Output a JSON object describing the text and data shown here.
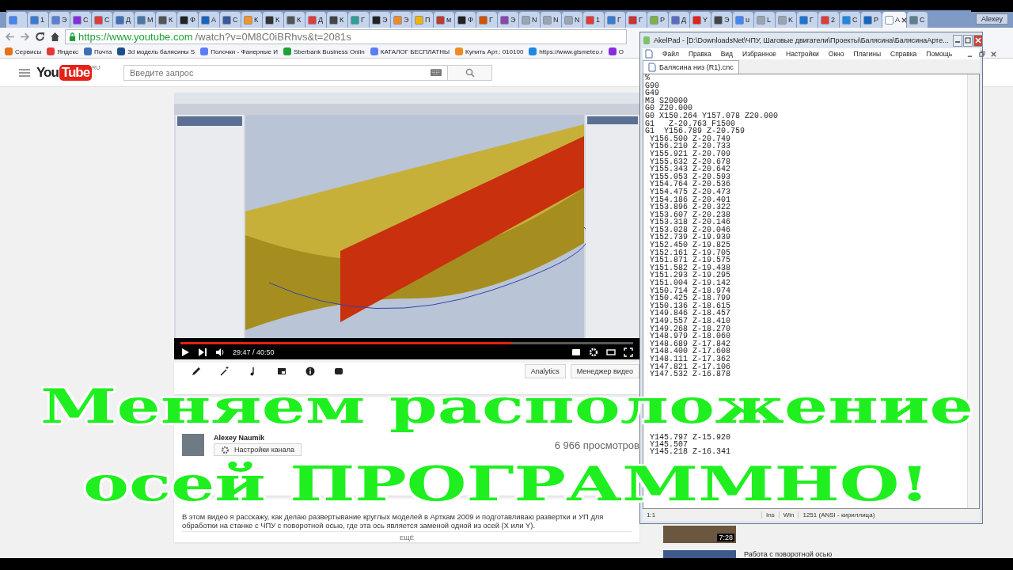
{
  "browser": {
    "tabs": [
      {
        "color": "#4285f4",
        "selected": false
      },
      {
        "label": "1",
        "color": "#3a7bd5",
        "selected": false
      },
      {
        "label": "Э",
        "color": "#5b7fd6",
        "selected": false
      },
      {
        "label": "С",
        "color": "#8a2be2",
        "selected": false
      },
      {
        "label": "С",
        "color": "#e53935",
        "selected": false
      },
      {
        "label": "Д",
        "color": "#3f6fb5",
        "selected": false
      },
      {
        "label": "М",
        "color": "#4a76a8",
        "selected": false
      },
      {
        "label": "К",
        "color": "#555555",
        "selected": false
      },
      {
        "label": "Ф",
        "color": "#222222",
        "selected": false
      },
      {
        "label": "А",
        "color": "#1565c0",
        "selected": false
      },
      {
        "label": "С",
        "color": "#3b5998",
        "selected": false
      },
      {
        "label": "К",
        "color": "#f7931e",
        "selected": false
      },
      {
        "label": "К",
        "color": "#333333",
        "selected": false
      },
      {
        "label": "К",
        "color": "#555555",
        "selected": false
      },
      {
        "label": "Д",
        "color": "#e53935",
        "selected": false
      },
      {
        "label": "К",
        "color": "#444444",
        "selected": false
      },
      {
        "label": "Г",
        "color": "#2aa198",
        "selected": false
      },
      {
        "label": "Э",
        "color": "#222222",
        "selected": false
      },
      {
        "label": "Э",
        "color": "#f08a24",
        "selected": false
      },
      {
        "label": "П",
        "color": "#f0b400",
        "selected": false
      },
      {
        "label": "м",
        "color": "#c0392b",
        "selected": false
      },
      {
        "label": "Ф",
        "color": "#222222",
        "selected": false
      },
      {
        "label": "Г",
        "color": "#d35400",
        "selected": false
      },
      {
        "label": "Э",
        "color": "#8e44ad",
        "selected": false
      },
      {
        "label": "N",
        "color": "#9aa4b2",
        "selected": false
      },
      {
        "label": "N",
        "color": "#9aa4b2",
        "selected": false
      },
      {
        "label": "N",
        "color": "#9aa4b2",
        "selected": false
      },
      {
        "label": "1",
        "color": "#e53935",
        "selected": false
      },
      {
        "label": "Г",
        "color": "#3a7bd5",
        "selected": false
      },
      {
        "label": "Г",
        "color": "#d32f2f",
        "selected": false
      },
      {
        "label": "Р",
        "color": "#7cb342",
        "selected": false
      },
      {
        "label": "Д",
        "color": "#5c6bc0",
        "selected": false
      },
      {
        "label": "Y",
        "color": "#e62117",
        "selected": false
      },
      {
        "label": "Э",
        "color": "#444444",
        "selected": false
      },
      {
        "label": "u",
        "color": "#4285f4",
        "selected": false
      },
      {
        "label": "L",
        "color": "#9aa4b2",
        "selected": false
      },
      {
        "label": "K",
        "color": "#9aa4b2",
        "selected": false
      },
      {
        "label": "Г",
        "color": "#1976d2",
        "selected": false
      },
      {
        "label": "2",
        "color": "#e53935",
        "selected": false
      },
      {
        "label": "С",
        "color": "#1e88e5",
        "selected": false
      },
      {
        "label": "Р",
        "color": "#1565c0",
        "selected": false
      },
      {
        "label": "A",
        "color": "#ffffff",
        "selected": true
      },
      {
        "label": "С",
        "color": "#607d8b",
        "selected": false
      }
    ],
    "profile": "Alexey",
    "url_host": "https://www.youtube.com",
    "url_path": "/watch?v=0M8C0iBRhvs&t=2081s",
    "bookmarks": [
      {
        "label": "Сервисы",
        "color": "#e8711c"
      },
      {
        "label": "Яндекс",
        "color": "#e53935"
      },
      {
        "label": "Почта",
        "color": "#3f6fb5"
      },
      {
        "label": "3d модель балясины S",
        "color": "#1b4f8a"
      },
      {
        "label": "Полочки - Фанерные И",
        "color": "#5c7cfa"
      },
      {
        "label": "Sberbank Business Onlin",
        "color": "#21a038"
      },
      {
        "label": "КАТАЛОГ БЕСПЛАТНЫ",
        "color": "#5c7cfa"
      },
      {
        "label": "Купить Арт.: 010100",
        "color": "#f08a24"
      },
      {
        "label": "https://www.gismeteo.r",
        "color": "#1e88e5"
      },
      {
        "label": "О",
        "color": "#8a2be2"
      }
    ]
  },
  "youtube": {
    "logo_you": "You",
    "logo_tube": "Tube",
    "logo_region": "RU",
    "search_placeholder": "Введите запрос",
    "player": {
      "time": "29:47 / 40:50",
      "level": 0.73
    },
    "buttons": [
      "Analytics",
      "Менеджер видео"
    ],
    "channel": {
      "name": "Alexey Naumik",
      "settings": "Настройки канала",
      "views": "6 966 просмотров"
    },
    "description": "В этом видео я расскажу, как делаю развертывание круглых моделей в Арткам 2009 и подготавливаю развертки и УП для обработки на станке с ЧПУ с поворотной осью, где эта ось является заменой одной из осей (X или Y).",
    "more": "ЕЩЁ",
    "related": [
      {
        "duration": "7:28"
      },
      {
        "title": "Работа с поворотной осью"
      }
    ]
  },
  "akelpad": {
    "title": "AkelPad - [D:\\DownloadsNet\\ЧПУ, Шаговые двигатели\\Проекты\\Балясина\\БалясинаАрте...",
    "menu": [
      "Файл",
      "Правка",
      "Вид",
      "Избранное",
      "Настройки",
      "Окно",
      "Плагины",
      "Справка",
      "Помощь"
    ],
    "tab": "Балясина низ (R1).cnc",
    "blocks": [
      [
        "%",
        "G90",
        "G49",
        "M3 S20000",
        "G0 Z20.000",
        "G0 X150.264 Y157.078 Z20.000",
        "G1   Z-20.763 F1500",
        "G1  Y156.789 Z-20.759",
        " Y156.500 Z-20.749",
        " Y156.210 Z-20.733",
        " Y155.921 Z-20.709",
        " Y155.632 Z-20.678",
        " Y155.343 Z-20.642",
        " Y155.053 Z-20.593",
        " Y154.764 Z-20.536",
        " Y154.475 Z-20.473",
        " Y154.186 Z-20.401",
        " Y153.896 Z-20.322",
        " Y153.607 Z-20.238",
        " Y153.318 Z-20.146",
        " Y153.028 Z-20.046",
        " Y152.739 Z-19.939",
        " Y152.450 Z-19.825",
        " Y152.161 Z-19.705",
        " Y151.871 Z-19.575",
        " Y151.582 Z-19.438",
        " Y151.293 Z-19.295",
        " Y151.004 Z-19.142",
        " Y150.714 Z-18.974",
        " Y150.425 Z-18.799",
        " Y150.136 Z-18.615",
        " Y149.846 Z-18.457",
        " Y149.557 Z-18.410",
        " Y149.268 Z-18.270",
        " Y148.979 Z-18.060",
        " Y148.689 Z-17.842",
        " Y148.400 Z-17.608",
        " Y148.111 Z-17.362",
        " Y147.821 Z-17.106",
        " Y147.532 Z-16.878"
      ],
      [
        " Y145.797 Z-15.920",
        " Y145.507",
        " Y145.218 Z-16.341"
      ]
    ],
    "status": [
      "1:1",
      "Ins",
      "Win",
      "1251  (ANSI - кириллица)"
    ]
  },
  "overlay": [
    "Меняем расположение",
    "осей ПРОГРАММНО!"
  ]
}
